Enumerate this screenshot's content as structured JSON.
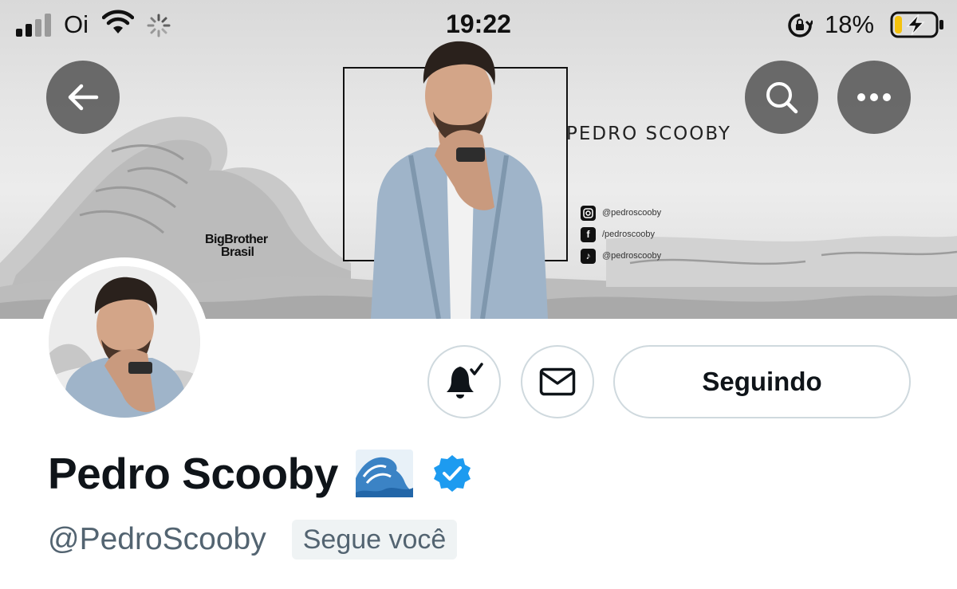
{
  "status_bar": {
    "carrier": "Oi",
    "time": "19:22",
    "battery_percent": "18%",
    "battery_level": 0.18,
    "battery_color": "#f4c20d"
  },
  "nav": {
    "back_icon": "arrow-left-icon",
    "search_icon": "search-icon",
    "more_icon": "more-horizontal-icon"
  },
  "banner": {
    "name": "PEDRO SCOOBY",
    "logo": "BigBrother Brasil",
    "socials": [
      {
        "icon": "instagram-icon",
        "text": "@pedroscooby"
      },
      {
        "icon": "facebook-icon",
        "text": "/pedroscooby"
      },
      {
        "icon": "tiktok-icon",
        "text": "@pedroscooby"
      }
    ]
  },
  "profile": {
    "display_name": "Pedro Scooby",
    "name_emoji": "water-wave-emoji",
    "verified_color": "#1d9bf0",
    "handle": "@PedroScooby",
    "follows_you_label": "Segue você"
  },
  "actions": {
    "notifications_icon": "bell-check-icon",
    "message_icon": "envelope-icon",
    "following_label": "Seguindo"
  }
}
